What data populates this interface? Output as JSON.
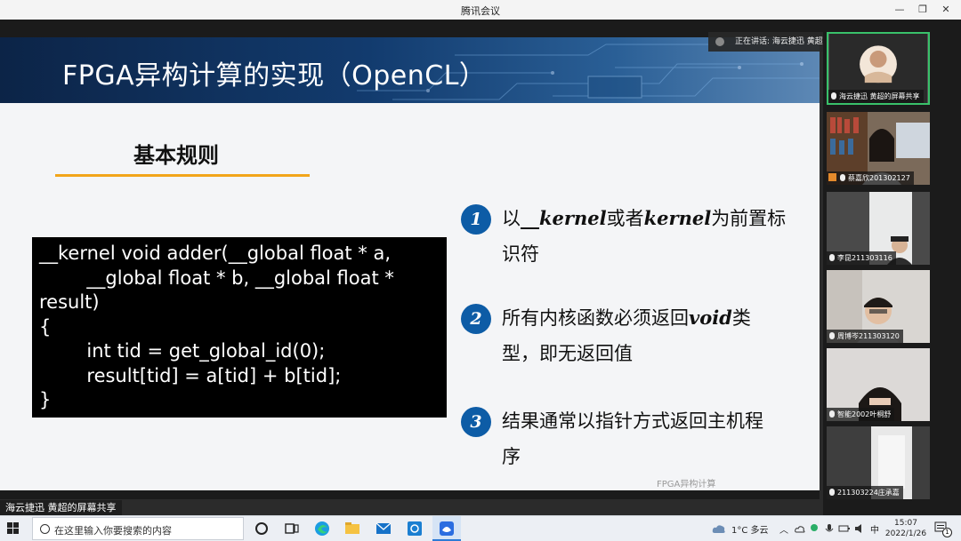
{
  "window": {
    "title": "腾讯会议",
    "controls": [
      "—",
      "❐",
      "✕"
    ]
  },
  "slide": {
    "title": "FPGA异构计算的实现（OpenCL）",
    "subtitle": "基本规则",
    "footer": "FPGA异构计算",
    "code": [
      "__kernel void adder(__global float * a,",
      "        __global float * b, __global float *",
      "result)",
      "{",
      "        int tid = get_global_id(0);",
      "        result[tid] = a[tid] + b[tid];",
      "}"
    ],
    "points": [
      {
        "num": "1",
        "pre": "以",
        "kw1": "__kernel",
        "mid": "或者",
        "kw2": "kernel",
        "post": "为前置标识符"
      },
      {
        "num": "2",
        "pre": "所有内核函数必须返回",
        "kw1": "void",
        "mid": "类型，即无返回值",
        "kw2": "",
        "post": ""
      },
      {
        "num": "3",
        "pre": "结果通常以指针方式返回主机程序",
        "kw1": "",
        "mid": "",
        "kw2": "",
        "post": ""
      }
    ]
  },
  "speaking": "正在讲话: 海云捷迅 黄超;",
  "share_label": "海云捷迅 黄超的屏幕共享",
  "participants": [
    {
      "name": "海云捷迅 黄超的屏幕共享",
      "active": true
    },
    {
      "name": "蔡嘉欣201302127",
      "active": false
    },
    {
      "name": "李昆211303116",
      "active": false
    },
    {
      "name": "周博岑211303120",
      "active": false
    },
    {
      "name": "智能2002叶桐舒",
      "active": false
    },
    {
      "name": "211303224庄承嘉",
      "active": false
    }
  ],
  "taskbar": {
    "search_placeholder": "在这里输入你要搜索的内容",
    "weather": "1°C  多云",
    "ime": "中",
    "time": "15:07",
    "date": "2022/1/26",
    "notification_count": "1"
  }
}
